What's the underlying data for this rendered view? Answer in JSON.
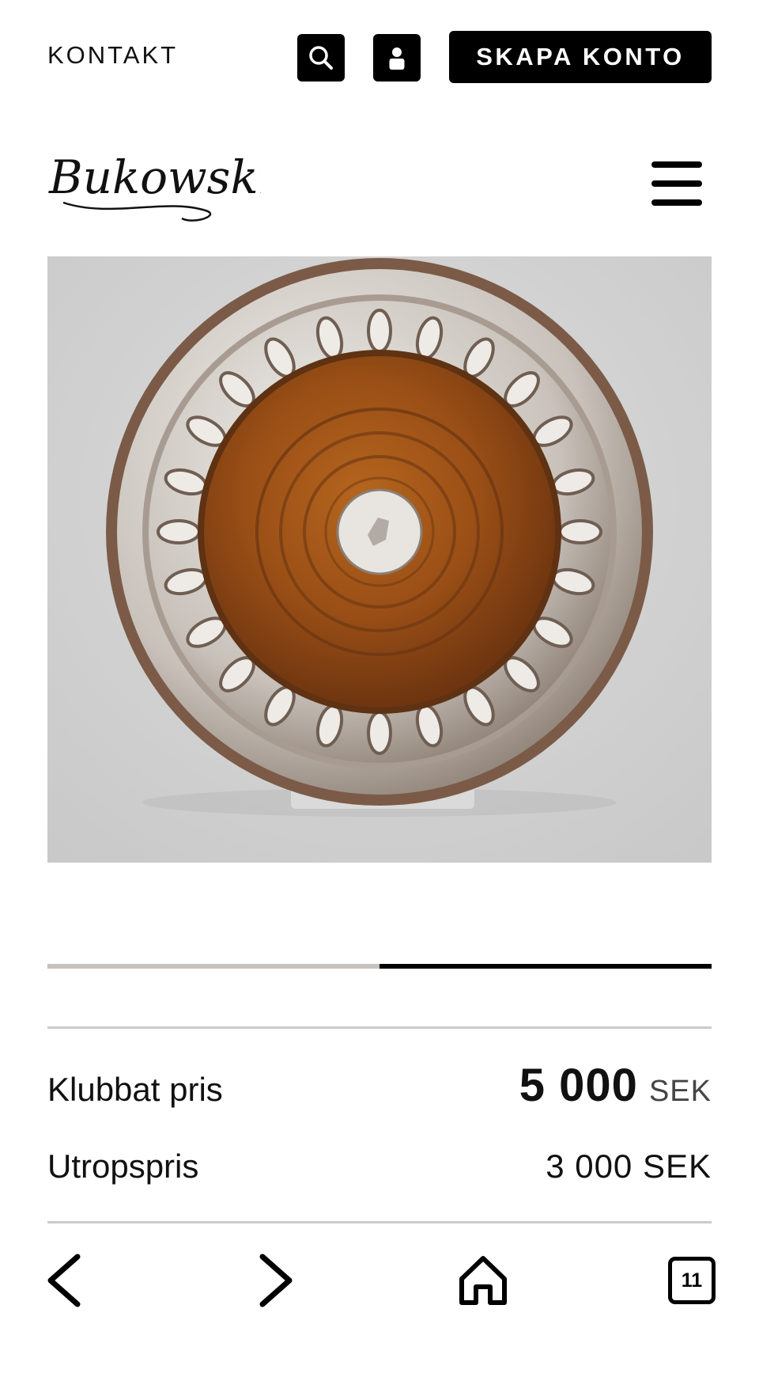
{
  "header": {
    "contact_label": "KONTAKT",
    "create_account_label": "SKAPA KONTO",
    "search_icon": "search-icon",
    "user_icon": "user-icon",
    "menu_icon": "hamburger-menu-icon"
  },
  "brand": {
    "logo_text": "Bukowskis"
  },
  "gallery": {
    "image_subject": "silver and wood wine coaster",
    "progress_fraction": 0.5
  },
  "prices": {
    "hammer_label": "Klubbat pris",
    "hammer_value": "5 000",
    "hammer_currency": "SEK",
    "estimate_label": "Utropspris",
    "estimate_value": "3 000 SEK"
  },
  "browser_nav": {
    "tab_count": "11",
    "icons": [
      "back-arrow-icon",
      "forward-arrow-icon",
      "home-icon",
      "tabs-icon"
    ]
  },
  "colors": {
    "accent": "#000000",
    "divider": "#cfcac6",
    "image_background": "#d6d6d6"
  }
}
